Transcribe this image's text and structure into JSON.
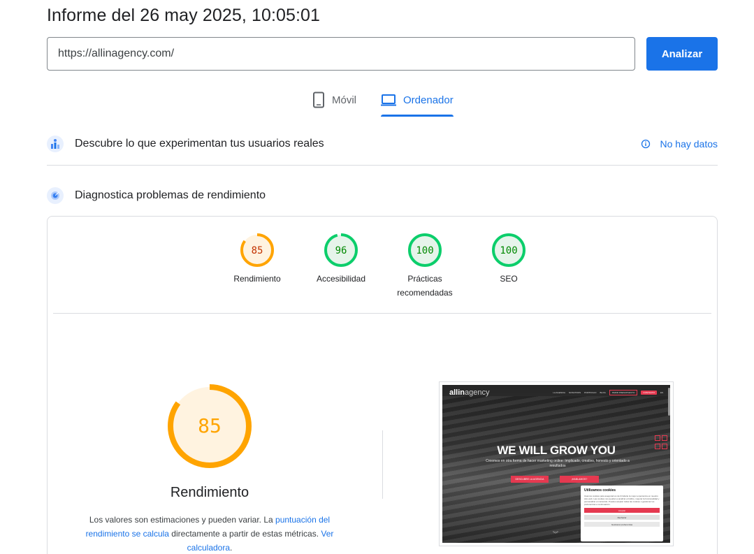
{
  "header": {
    "title": "Informe del 26 may 2025, 10:05:01"
  },
  "url_bar": {
    "value": "https://allinagency.com/",
    "analyze_label": "Analizar"
  },
  "device_tabs": {
    "mobile": "Móvil",
    "desktop": "Ordenador",
    "active": "desktop"
  },
  "field_data": {
    "title": "Descubre lo que experimentan tus usuarios reales",
    "status": "No hay datos"
  },
  "lab_data": {
    "title": "Diagnostica problemas de rendimiento"
  },
  "scores": [
    {
      "label": "Rendimiento",
      "value": "85",
      "color": "#ffa400",
      "text_color": "#c33300",
      "bg": "#fff3e0"
    },
    {
      "label": "Accesibilidad",
      "value": "96",
      "color": "#0cce6b",
      "text_color": "#008800",
      "bg": "#e6f4ea"
    },
    {
      "label": "Prácticas recomendadas",
      "value": "100",
      "color": "#0cce6b",
      "text_color": "#008800",
      "bg": "#e6f4ea"
    },
    {
      "label": "SEO",
      "value": "100",
      "color": "#0cce6b",
      "text_color": "#008800",
      "bg": "#e6f4ea"
    }
  ],
  "performance_detail": {
    "score": "85",
    "score_fraction": 0.85,
    "label": "Rendimiento",
    "desc_prefix": "Los valores son estimaciones y pueden variar. La ",
    "desc_link1": "puntuación del rendimiento se calcula",
    "desc_middle": " directamente a partir de estas métricas. ",
    "desc_link2": "Ver calculadora",
    "desc_suffix": "."
  },
  "screenshot": {
    "logo_bold": "allin",
    "logo_light": "agency",
    "nav": [
      "LA AGENCIA",
      "NOSOTROS",
      "PORTFOLIO",
      "BLOG"
    ],
    "nav_outline": "PEDIR PRESUPUESTO",
    "nav_pill": "CONTACTO",
    "nav_lang": "ES",
    "headline": "WE WILL GROW YOU",
    "subheadline": "Creemos en otra forma de hacer marketing online: Implicado, creativo, honesto y orientado a resultados",
    "btn1": "DESCUBRE LA AGENCIA",
    "btn2": "¡HABLAMOS?",
    "cookie_title": "Utilizamos cookies",
    "cookie_text": "Usamos cookies para asegurarnos de brindarte la mejor experiencia en nuestro sitio web. Las cookies nos ayudan a analizar el tráfico, mejorar la funcionalidad y personalizar el contenido. Puedes aceptar todas las cookies o gestionar tus preferencias a continuación.",
    "cookie_accept": "Aceptar",
    "cookie_reject": "Rechazar",
    "cookie_prefs": "Gestionar preferencias"
  }
}
